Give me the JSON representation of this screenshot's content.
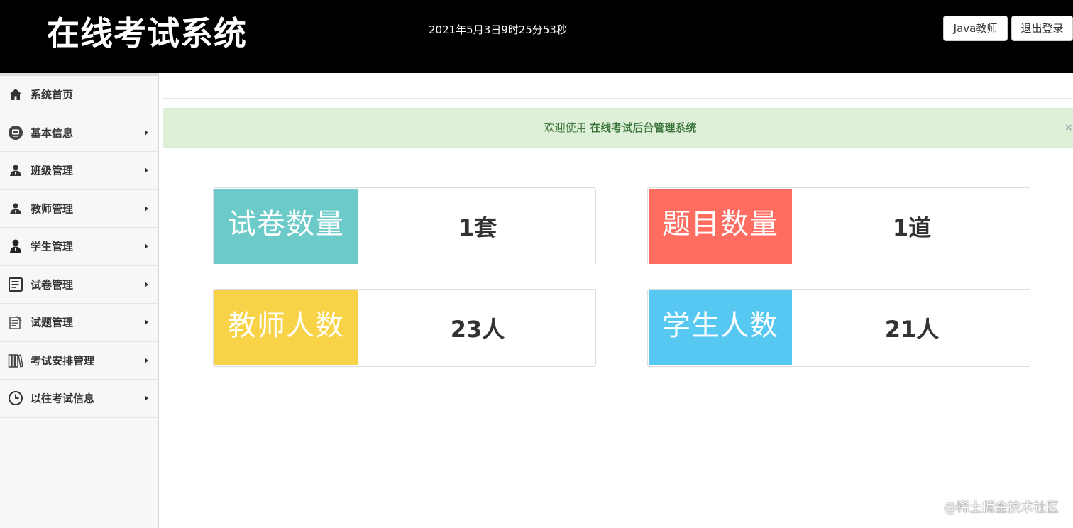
{
  "header": {
    "logo": "在线考试系统",
    "clock": "2021年5月3日9时25分53秒",
    "user_button": "Java教师",
    "logout_button": "退出登录",
    "bg_color": "#000000"
  },
  "sidebar": {
    "items": [
      {
        "label": "系统首页",
        "icon": "home-icon",
        "has_submenu": false
      },
      {
        "label": "基本信息",
        "icon": "monitor-icon",
        "has_submenu": true
      },
      {
        "label": "班级管理",
        "icon": "users-icon",
        "has_submenu": true
      },
      {
        "label": "教师管理",
        "icon": "users-icon",
        "has_submenu": true
      },
      {
        "label": "学生管理",
        "icon": "user-icon",
        "has_submenu": true
      },
      {
        "label": "试卷管理",
        "icon": "document-icon",
        "has_submenu": true
      },
      {
        "label": "试题管理",
        "icon": "edit-icon",
        "has_submenu": true
      },
      {
        "label": "考试安排管理",
        "icon": "books-icon",
        "has_submenu": true
      },
      {
        "label": "以往考试信息",
        "icon": "clock-icon",
        "has_submenu": true
      }
    ]
  },
  "alert": {
    "prefix": "欢迎使用",
    "strong": "在线考试后台管理系统",
    "close": "×"
  },
  "cards": [
    {
      "label": "试卷数量",
      "value": "1套",
      "color": "#6ccac9"
    },
    {
      "label": "题目数量",
      "value": "1道",
      "color": "#ff6c60"
    },
    {
      "label": "教师人数",
      "value": "23人",
      "color": "#f8d347"
    },
    {
      "label": "学生人数",
      "value": "21人",
      "color": "#57c8f2"
    }
  ],
  "watermark": "@稀土掘金技术社区"
}
